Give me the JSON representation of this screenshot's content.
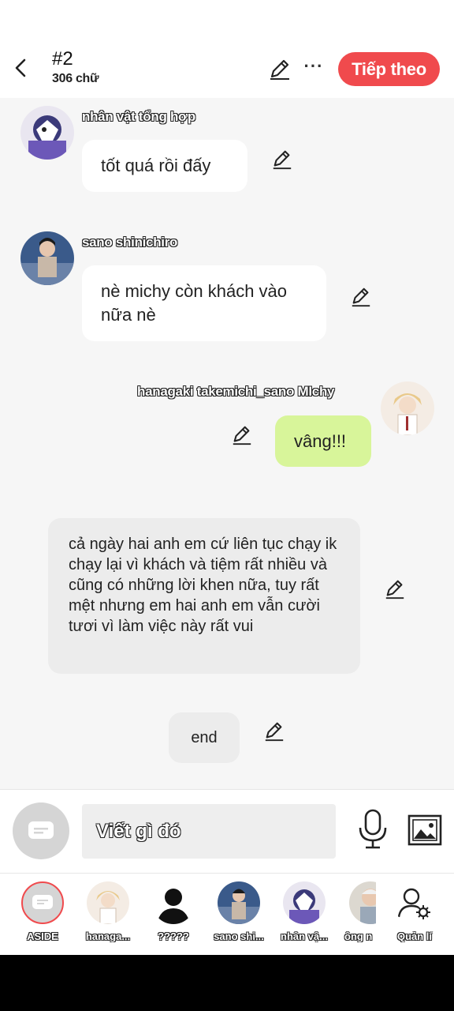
{
  "header": {
    "title": "#2",
    "word_count": "306 chữ",
    "next_label": "Tiếp theo",
    "accent_color": "#f04a4d"
  },
  "messages": [
    {
      "name": "nhân vật tổng hợp",
      "text": "tốt quá rồi đấy",
      "side": "left"
    },
    {
      "name": "sano shinichiro",
      "text": "nè michy còn khách vào nữa nè",
      "side": "left"
    },
    {
      "name": "hanagaki takemichi_sano MIchy",
      "text": "vâng!!!",
      "side": "right",
      "bubble_color": "#d8f59a"
    },
    {
      "text": "cả ngày hai anh em cứ liên tục chạy ik chạy lại vì khách và tiệm rất nhiều và cũng có những lời khen nữa, tuy rất mệt nhưng em hai anh em vẫn cười tươi vì làm việc này rất vui",
      "side": "narration"
    },
    {
      "text": "end",
      "side": "narration"
    }
  ],
  "composer": {
    "placeholder": "Viết gì đó",
    "icons": [
      "aside-icon",
      "microphone-icon",
      "image-icon"
    ]
  },
  "characters": [
    {
      "label": "ASIDE"
    },
    {
      "label": "hanaga..."
    },
    {
      "label": "?????"
    },
    {
      "label": "sano shi..."
    },
    {
      "label": "nhân vậ..."
    },
    {
      "label": "ông n"
    },
    {
      "label": "Quản lí"
    }
  ]
}
